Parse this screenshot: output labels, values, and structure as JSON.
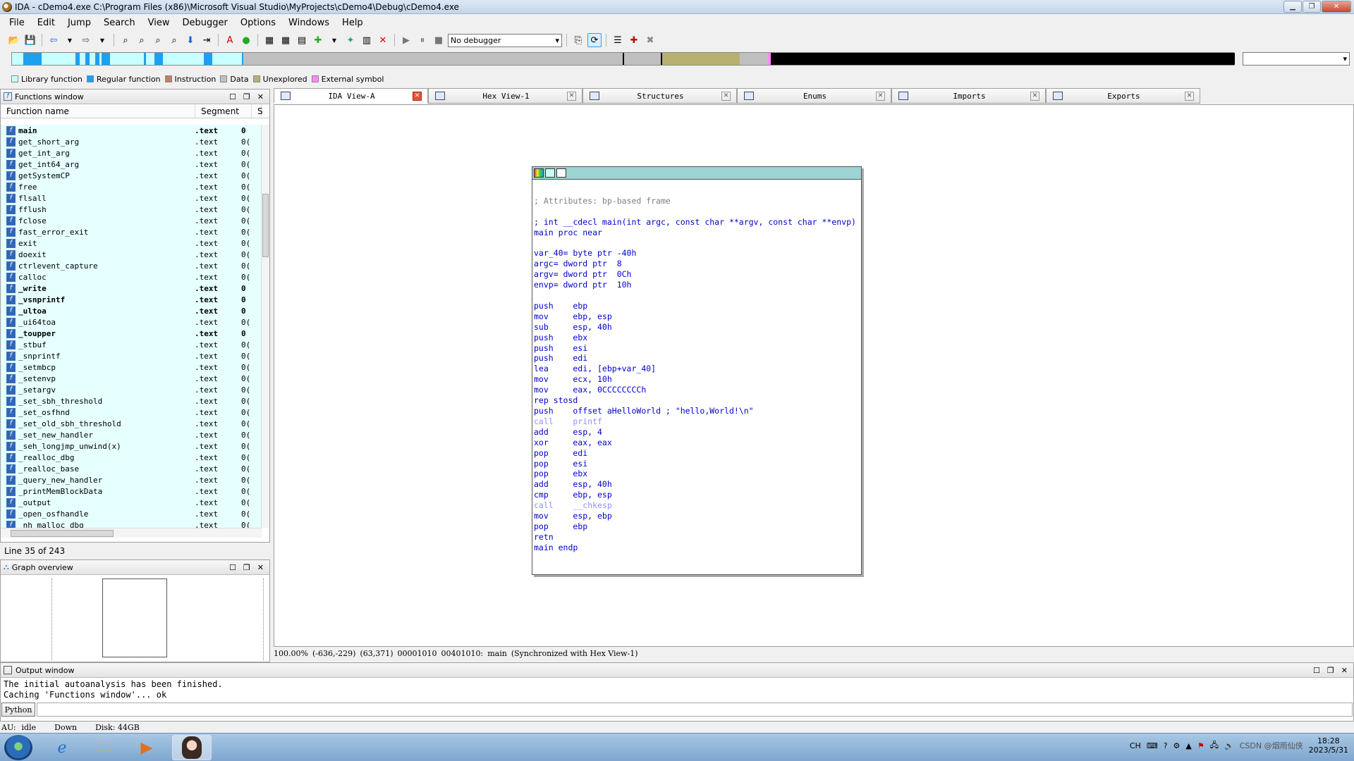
{
  "window": {
    "title": "IDA - cDemo4.exe C:\\Program Files (x86)\\Microsoft Visual Studio\\MyProjects\\cDemo4\\Debug\\cDemo4.exe"
  },
  "menu": [
    "File",
    "Edit",
    "Jump",
    "Search",
    "View",
    "Debugger",
    "Options",
    "Windows",
    "Help"
  ],
  "toolbar": {
    "debugger_select": "No debugger"
  },
  "legend": [
    {
      "label": "Library function",
      "color": "#c8ffff"
    },
    {
      "label": "Regular function",
      "color": "#1ea0f0"
    },
    {
      "label": "Instruction",
      "color": "#c08060"
    },
    {
      "label": "Data",
      "color": "#c0c0c0"
    },
    {
      "label": "Unexplored",
      "color": "#b8b070"
    },
    {
      "label": "External symbol",
      "color": "#ff88ff"
    }
  ],
  "functions_window": {
    "title": "Functions window",
    "col_name": "Function name",
    "col_segment": "Segment",
    "col_s": "S",
    "rows": [
      {
        "name": "main",
        "seg": ".text",
        "s": "0",
        "bold": true
      },
      {
        "name": "get_short_arg",
        "seg": ".text",
        "s": "0("
      },
      {
        "name": "get_int_arg",
        "seg": ".text",
        "s": "0("
      },
      {
        "name": "get_int64_arg",
        "seg": ".text",
        "s": "0("
      },
      {
        "name": "getSystemCP",
        "seg": ".text",
        "s": "0("
      },
      {
        "name": "free",
        "seg": ".text",
        "s": "0("
      },
      {
        "name": "flsall",
        "seg": ".text",
        "s": "0("
      },
      {
        "name": "fflush",
        "seg": ".text",
        "s": "0("
      },
      {
        "name": "fclose",
        "seg": ".text",
        "s": "0("
      },
      {
        "name": "fast_error_exit",
        "seg": ".text",
        "s": "0("
      },
      {
        "name": "exit",
        "seg": ".text",
        "s": "0("
      },
      {
        "name": "doexit",
        "seg": ".text",
        "s": "0("
      },
      {
        "name": "ctrlevent_capture",
        "seg": ".text",
        "s": "0("
      },
      {
        "name": "calloc",
        "seg": ".text",
        "s": "0("
      },
      {
        "name": "_write",
        "seg": ".text",
        "s": "0",
        "bold": true
      },
      {
        "name": "_vsnprintf",
        "seg": ".text",
        "s": "0",
        "bold": true
      },
      {
        "name": "_ultoa",
        "seg": ".text",
        "s": "0",
        "bold": true
      },
      {
        "name": "_ui64toa",
        "seg": ".text",
        "s": "0("
      },
      {
        "name": "_toupper",
        "seg": ".text",
        "s": "0",
        "bold": true
      },
      {
        "name": "_stbuf",
        "seg": ".text",
        "s": "0("
      },
      {
        "name": "_snprintf",
        "seg": ".text",
        "s": "0("
      },
      {
        "name": "_setmbcp",
        "seg": ".text",
        "s": "0("
      },
      {
        "name": "_setenvp",
        "seg": ".text",
        "s": "0("
      },
      {
        "name": "_setargv",
        "seg": ".text",
        "s": "0("
      },
      {
        "name": "_set_sbh_threshold",
        "seg": ".text",
        "s": "0("
      },
      {
        "name": "_set_osfhnd",
        "seg": ".text",
        "s": "0("
      },
      {
        "name": "_set_old_sbh_threshold",
        "seg": ".text",
        "s": "0("
      },
      {
        "name": "_set_new_handler",
        "seg": ".text",
        "s": "0("
      },
      {
        "name": "_seh_longjmp_unwind(x)",
        "seg": ".text",
        "s": "0("
      },
      {
        "name": "_realloc_dbg",
        "seg": ".text",
        "s": "0("
      },
      {
        "name": "_realloc_base",
        "seg": ".text",
        "s": "0("
      },
      {
        "name": "_query_new_handler",
        "seg": ".text",
        "s": "0("
      },
      {
        "name": "_printMemBlockData",
        "seg": ".text",
        "s": "0("
      },
      {
        "name": "_output",
        "seg": ".text",
        "s": "0("
      },
      {
        "name": "_open_osfhandle",
        "seg": ".text",
        "s": "0("
      },
      {
        "name": "_nh_malloc_dbg",
        "seg": ".text",
        "s": "0("
      }
    ],
    "line_info": "Line 35 of 243"
  },
  "graph_overview": {
    "title": "Graph overview"
  },
  "tabs": [
    {
      "label": "IDA View-A",
      "active": true
    },
    {
      "label": "Hex View-1"
    },
    {
      "label": "Structures"
    },
    {
      "label": "Enums"
    },
    {
      "label": "Imports"
    },
    {
      "label": "Exports"
    }
  ],
  "disasm": [
    {
      "t": ""
    },
    {
      "t": "; Attributes: bp-based frame",
      "c": "c-com"
    },
    {
      "t": ""
    },
    {
      "t": "; int __cdecl main(int argc, const char **argv, const char **envp)",
      "c": "c-blue"
    },
    {
      "t": "main proc near",
      "c": "c-blue"
    },
    {
      "t": ""
    },
    {
      "t": "var_40= byte ptr -40h",
      "c": "c-blue"
    },
    {
      "t": "argc= dword ptr  8",
      "c": "c-blue"
    },
    {
      "t": "argv= dword ptr  0Ch",
      "c": "c-blue"
    },
    {
      "t": "envp= dword ptr  10h",
      "c": "c-blue"
    },
    {
      "t": ""
    },
    {
      "t": "push    ebp",
      "c": "c-blue"
    },
    {
      "t": "mov     ebp, esp",
      "c": "c-blue"
    },
    {
      "t": "sub     esp, 40h",
      "c": "c-blue"
    },
    {
      "t": "push    ebx",
      "c": "c-blue"
    },
    {
      "t": "push    esi",
      "c": "c-blue"
    },
    {
      "t": "push    edi",
      "c": "c-blue"
    },
    {
      "t": "lea     edi, [ebp+var_40]",
      "c": "c-blue"
    },
    {
      "t": "mov     ecx, 10h",
      "c": "c-blue"
    },
    {
      "t": "mov     eax, 0CCCCCCCCh",
      "c": "c-blue"
    },
    {
      "t": "rep stosd",
      "c": "c-blue"
    },
    {
      "t": "push    offset aHelloWorld ; \"hello,World!\\n\"",
      "c": "c-blue"
    },
    {
      "t": "call    printf",
      "c": "c-fn"
    },
    {
      "t": "add     esp, 4",
      "c": "c-blue"
    },
    {
      "t": "xor     eax, eax",
      "c": "c-blue"
    },
    {
      "t": "pop     edi",
      "c": "c-blue"
    },
    {
      "t": "pop     esi",
      "c": "c-blue"
    },
    {
      "t": "pop     ebx",
      "c": "c-blue"
    },
    {
      "t": "add     esp, 40h",
      "c": "c-blue"
    },
    {
      "t": "cmp     ebp, esp",
      "c": "c-blue"
    },
    {
      "t": "call    __chkesp",
      "c": "c-fn"
    },
    {
      "t": "mov     esp, ebp",
      "c": "c-blue"
    },
    {
      "t": "pop     ebp",
      "c": "c-blue"
    },
    {
      "t": "retn",
      "c": "c-blue"
    },
    {
      "t": "main endp",
      "c": "c-blue"
    }
  ],
  "status_line": {
    "zoom": "100.00%",
    "coords1": "(-636,-229)",
    "coords2": "(63,371)",
    "offset": "00001010",
    "address": "00401010:",
    "func": "main",
    "sync": "(Synchronized with Hex View-1)"
  },
  "output_window": {
    "title": "Output window",
    "lines": [
      "The initial autoanalysis has been finished.",
      "Caching 'Functions window'... ok"
    ],
    "python_label": "Python"
  },
  "bottom_status": {
    "au": "AU:",
    "state": "idle",
    "dir": "Down",
    "disk": "Disk: 44GB"
  },
  "taskbar": {
    "lang": "CH",
    "time": "18:28",
    "date": "2023/5/31",
    "watermark": "CSDN @烟雨仙侠"
  }
}
